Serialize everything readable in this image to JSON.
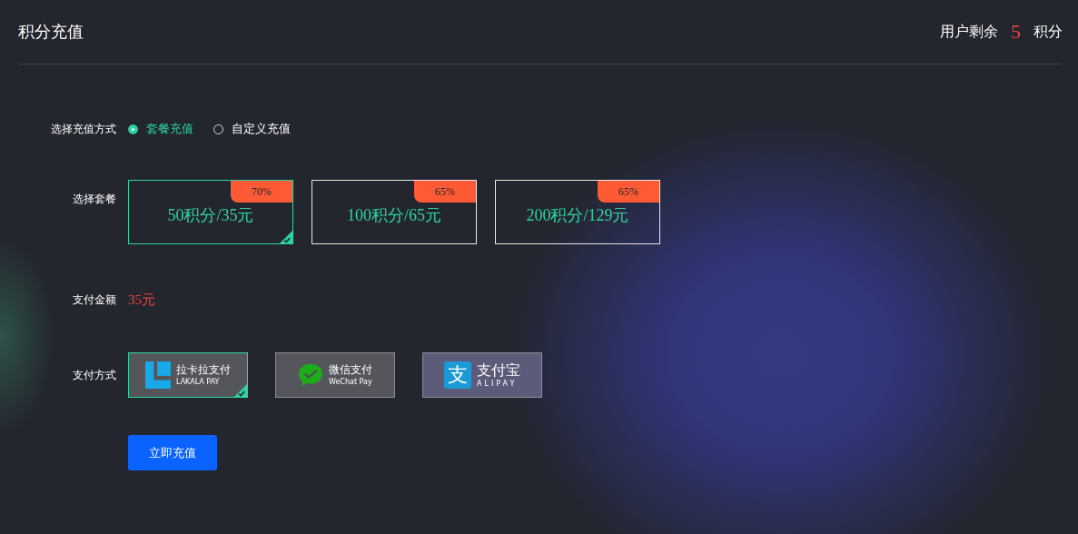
{
  "header": {
    "title": "积分充值",
    "balance_prefix": "用户剩余",
    "balance_value": "5",
    "balance_suffix": "积分"
  },
  "recharge_mode": {
    "label": "选择充值方式",
    "options": [
      {
        "label": "套餐充值",
        "selected": true
      },
      {
        "label": "自定义充值",
        "selected": false
      }
    ]
  },
  "packages": {
    "label": "选择套餐",
    "items": [
      {
        "name": "50积分/35元",
        "discount": "70%",
        "selected": true
      },
      {
        "name": "100积分/65元",
        "discount": "65%",
        "selected": false
      },
      {
        "name": "200积分/129元",
        "discount": "65%",
        "selected": false
      }
    ]
  },
  "amount": {
    "label": "支付金额",
    "value": "35元"
  },
  "payment": {
    "label": "支付方式",
    "methods": [
      {
        "kind": "lakala",
        "name": "拉卡拉支付",
        "subtitle": "LAKALA PAY",
        "selected": true
      },
      {
        "kind": "wechat",
        "name": "微信支付",
        "subtitle": "WeChat Pay",
        "selected": false
      },
      {
        "kind": "alipay",
        "glyph": "支",
        "name": "支付宝",
        "subtitle": "ALIPAY",
        "selected": false
      }
    ]
  },
  "submit": "立即充值"
}
